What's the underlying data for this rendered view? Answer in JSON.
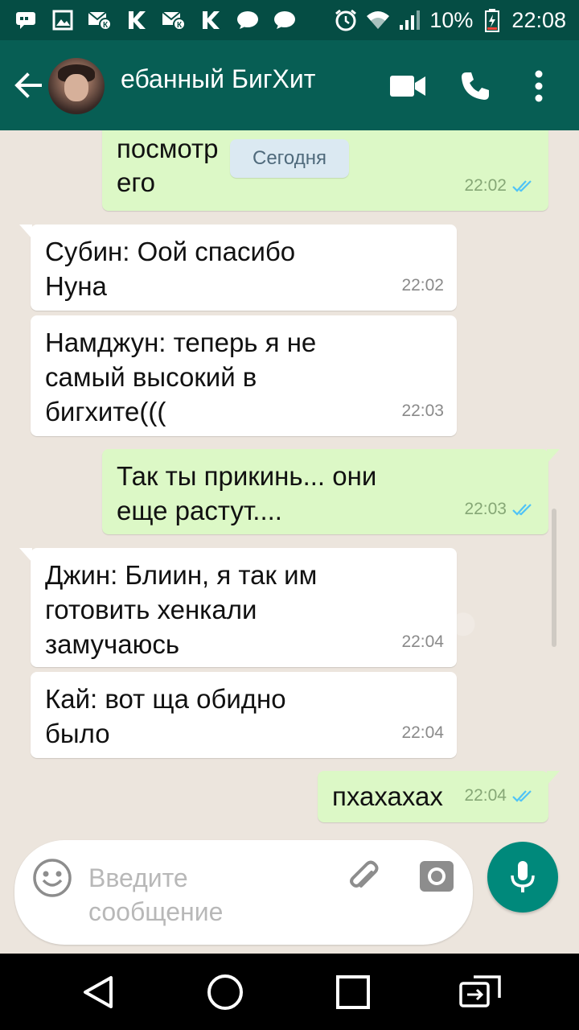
{
  "status_bar": {
    "battery": "10%",
    "time": "22:08",
    "icons": [
      "notification-icon",
      "image-icon",
      "mail-icon",
      "k-icon",
      "mail-icon",
      "k-icon",
      "chat-icon",
      "chat-icon",
      "alarm-icon",
      "wifi-icon",
      "signal-icon",
      "battery-icon"
    ]
  },
  "header": {
    "title": "ебанный БигХит",
    "icons": [
      "back-arrow-icon",
      "video-call-icon",
      "phone-icon",
      "more-vert-icon"
    ]
  },
  "chat": {
    "date_chip": "Сегодня",
    "messages": [
      {
        "dir": "out",
        "text": "посмотр         ешь\nего",
        "time": "22:02",
        "read": true
      },
      {
        "dir": "in",
        "text": "Субин: Оой спасибо\nНуна",
        "time": "22:02"
      },
      {
        "dir": "in",
        "text": "Намджун: теперь я не\nсамый высокий в\nбигхите(((",
        "time": "22:03"
      },
      {
        "dir": "out",
        "text": "Так ты прикинь... они\nеще растут....",
        "time": "22:03",
        "read": true
      },
      {
        "dir": "in",
        "text": "Джин: Блиин, я так им\nготовить хенкали\nзамучаюсь",
        "time": "22:04"
      },
      {
        "dir": "in",
        "text": "Кай: вот ща обидно\nбыло",
        "time": "22:04"
      },
      {
        "dir": "out",
        "text": "пхахахах",
        "time": "22:04",
        "read": true
      }
    ]
  },
  "input": {
    "placeholder": "Введите\nсообщение"
  },
  "colors": {
    "status_bar": "#054d44",
    "app_bar": "#075e54",
    "outgoing_bubble": "#dcf8c6",
    "incoming_bubble": "#ffffff",
    "read_tick": "#4fc3f7",
    "mic_button": "#00897b"
  }
}
